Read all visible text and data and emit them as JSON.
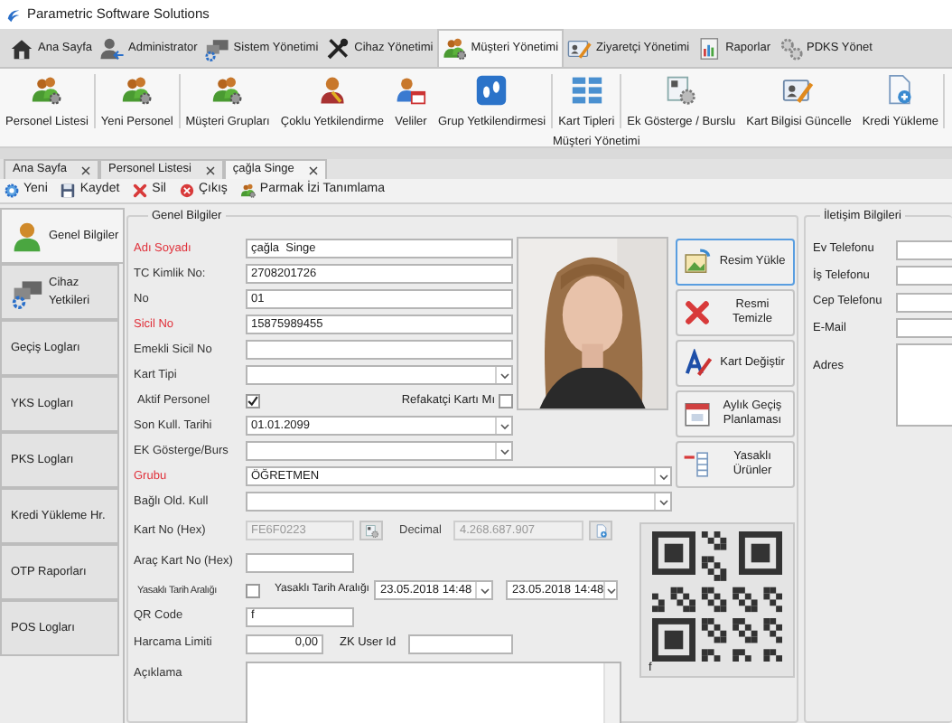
{
  "window": {
    "title": "Parametric Software Solutions"
  },
  "main_tabs": [
    {
      "label": "Ana Sayfa",
      "selected": false
    },
    {
      "label": "Administrator",
      "selected": false
    },
    {
      "label": "Sistem Yönetimi",
      "selected": false
    },
    {
      "label": "Cihaz Yönetimi",
      "selected": false
    },
    {
      "label": "Müşteri Yönetimi",
      "selected": true
    },
    {
      "label": "Ziyaretçi Yönetimi",
      "selected": false
    },
    {
      "label": "Raporlar",
      "selected": false
    },
    {
      "label": "PDKS Yönet",
      "selected": false
    }
  ],
  "ribbon": {
    "items": [
      {
        "label": "Personel Listesi"
      },
      {
        "label": "Yeni Personel"
      },
      {
        "label": "Müşteri Grupları"
      },
      {
        "label": "Çoklu Yetkilendirme"
      },
      {
        "label": "Veliler"
      },
      {
        "label": "Grup Yetkilendirmesi"
      },
      {
        "label": "Kart Tipleri"
      },
      {
        "label": "Ek Gösterge / Burslu"
      },
      {
        "label": "Kart Bilgisi Güncelle"
      },
      {
        "label": "Kredi Yükleme"
      }
    ],
    "group_label": "Müşteri Yönetimi"
  },
  "document_tabs": [
    {
      "label": "Ana Sayfa",
      "selected": false
    },
    {
      "label": "Personel Listesi",
      "selected": false
    },
    {
      "label": "çağla  Singe",
      "selected": true
    }
  ],
  "toolbar": [
    "Yeni",
    "Kaydet",
    "Sil",
    "Çıkış",
    "Parmak İzi Tanımlama"
  ],
  "sidebar": [
    {
      "label": "Genel Bilgiler",
      "selected": true
    },
    {
      "label": "Cihaz Yetkileri",
      "selected": false
    },
    {
      "label": "Geçiş Logları",
      "selected": false
    },
    {
      "label": "YKS Logları",
      "selected": false
    },
    {
      "label": "PKS Logları",
      "selected": false
    },
    {
      "label": "Kredi Yükleme Hr.",
      "selected": false
    },
    {
      "label": "OTP Raporları",
      "selected": false
    },
    {
      "label": "POS Logları",
      "selected": false
    }
  ],
  "general": {
    "title": "Genel Bilgiler",
    "fields": [
      {
        "kind": "text",
        "label": "Adı Soyadı",
        "value": "çağla  Singe",
        "required": true
      },
      {
        "kind": "text",
        "label": "TC Kimlik No:",
        "value": "2708201726",
        "required": false
      },
      {
        "kind": "text",
        "label": "No",
        "value": "01",
        "required": false
      },
      {
        "kind": "text",
        "label": "Sicil No",
        "value": "15875989455",
        "required": true
      },
      {
        "kind": "text",
        "label": "Emekli Sicil No",
        "required": false
      },
      {
        "kind": "select",
        "label": "Kart Tipi",
        "required": false
      },
      {
        "kind": "checks",
        "label": "Aktif Personel",
        "checked": true,
        "second_label": "Refakatçi Kartı Mı",
        "second_checked": false,
        "required": false
      },
      {
        "kind": "select",
        "label": "Son Kull. Tarihi",
        "value": "01.01.2099",
        "required": false
      },
      {
        "kind": "select",
        "label": "EK Gösterge/Burs",
        "required": false
      },
      {
        "kind": "wide_select",
        "label": "Grubu",
        "value": "ÖĞRETMEN",
        "required": true
      },
      {
        "kind": "wide_select",
        "label": "Bağlı Old. Kull",
        "required": false
      },
      {
        "kind": "card",
        "label": "Kart No (Hex)",
        "value": "FE6F0223",
        "decimal_label": "Decimal",
        "decimal_value": "4.268.687.907",
        "required": false
      },
      {
        "kind": "short",
        "label": "Araç Kart No (Hex)",
        "required": false
      },
      {
        "kind": "range",
        "label": "Yasaklı Tarih Aralığı",
        "checked": false,
        "second_label": "Yasaklı Tarih Aralığı",
        "from": "23.05.2018 14:48",
        "to": "23.05.2018 14:48",
        "required": false
      },
      {
        "kind": "short",
        "label": "QR Code",
        "value": "f",
        "required": false
      },
      {
        "kind": "limit",
        "label": "Harcama Limiti",
        "value": "0,00",
        "second_label": "ZK User Id",
        "required": false
      },
      {
        "kind": "textarea",
        "label": "Açıklama",
        "required": false
      }
    ]
  },
  "photo_buttons": [
    {
      "label": "Resim Yükle",
      "focused": true
    },
    {
      "label": "Resmi Temizle",
      "focused": false
    },
    {
      "label": "Kart Değiştir",
      "focused": false
    },
    {
      "label": "Aylık Geçiş Planlaması",
      "focused": false
    },
    {
      "label": "Yasaklı Ürünler",
      "focused": false
    }
  ],
  "qr": {
    "caption": "f"
  },
  "contact": {
    "title": "İletişim Bilgileri",
    "fields": [
      {
        "kind": "text",
        "label": "Ev Telefonu"
      },
      {
        "kind": "text",
        "label": "İş Telefonu"
      },
      {
        "kind": "text",
        "label": "Cep Telefonu"
      },
      {
        "kind": "text",
        "label": "E-Mail"
      },
      {
        "kind": "textarea",
        "label": "Adres"
      }
    ]
  }
}
